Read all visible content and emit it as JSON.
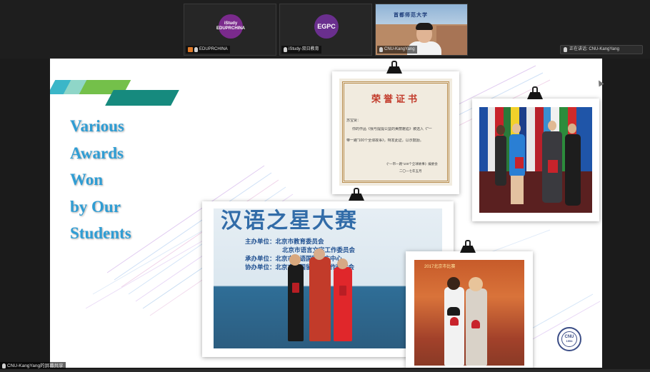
{
  "participants": [
    {
      "name": "EDUPRCHINA",
      "logo_text": "iStudy EDUPRCHINA",
      "logo_color": "#7a2a8c",
      "mic": "on"
    },
    {
      "name": "iStudy-双日教育",
      "logo_text": "EGPC",
      "logo_color": "#6a2f8e",
      "mic": "on"
    },
    {
      "name": "CNU-KangYang",
      "banner_text": "首都师范大学",
      "mic": "on"
    }
  ],
  "speaker_indicator": "正在讲话: CNU-KangYang",
  "slide": {
    "title_lines": [
      "Various",
      "Awards",
      "Won",
      "by Our",
      "Students"
    ],
    "title_color": "#2f9dd4",
    "certificate": {
      "title": "荣誉证书",
      "line1": "苏宝贤：",
      "line2": "你的作品《我与提提公益的美丽邂逅》被选入《\"一",
      "line3": "带一路\"100个全球故事》，特发此证，以示鼓励。",
      "footer1": "《\"一带一路\"100个全球故事》编委会",
      "footer2": "二〇一七年五月"
    },
    "stage_photo": {
      "banner_title": "汉语之星大赛",
      "line1": "主办单位：北京市教育委员会",
      "line2": "北京市语言文字工作委员会",
      "line3": "承办单位：北京市汉语国际推广中心",
      "line4": "协办单位：北京市外国留学生工作研究会"
    },
    "award_photo_caption": "2017北京市比赛",
    "seal_text": "CNU",
    "seal_year": "1954"
  },
  "self_label": "CNU-KangYang的屏幕共享",
  "colors": {
    "accent_teal": "#168a7e",
    "accent_green": "#74c04a",
    "accent_cyan": "#3bb6c8"
  }
}
